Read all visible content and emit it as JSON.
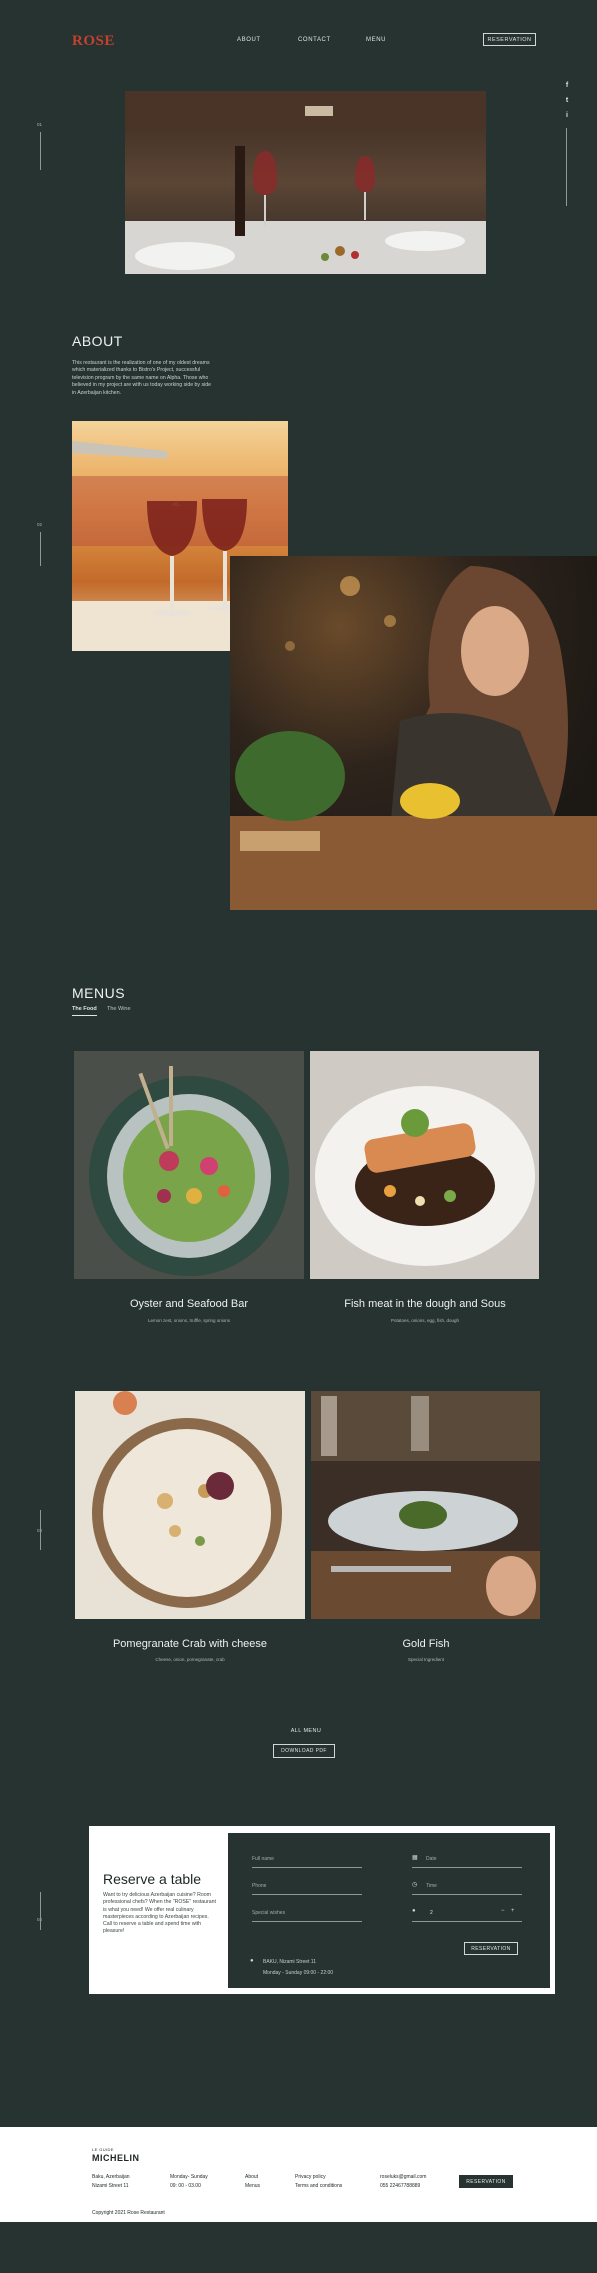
{
  "brand": {
    "name": "ROSE",
    "accent": "#c3412f",
    "background": "#273331"
  },
  "nav": {
    "items": [
      "ABOUT",
      "CONTACT",
      "MENU"
    ],
    "reservation": "RESERVATION"
  },
  "side_markers": [
    "01",
    "02",
    "03",
    "04"
  ],
  "social": {
    "facebook": "f",
    "twitter": "t",
    "instagram": "i"
  },
  "about": {
    "title": "ABOUT",
    "text": "This restaurant is the realization of one of my oldest dreams which materialized thanks to Bistro's Project, successful television program by the same name on Alpha. Those who believed in my project are with us today working side by side in Azerbaijan kitchen."
  },
  "menus": {
    "title": "MENUS",
    "tabs": [
      "The Food",
      "The Wine"
    ],
    "dishes": [
      {
        "name": "Oyster and Seafood Bar",
        "desc": "Lemon zest, onions, truffle, spring onions"
      },
      {
        "name": "Fish meat in the dough and Sous",
        "desc": "Potatoes, onions, egg, fish, dough"
      },
      {
        "name": "Pomegranate Crab with cheese",
        "desc": "Cheese, onion, pomegranate, crab"
      },
      {
        "name": "Gold Fish",
        "desc": "Special Ingredient"
      }
    ],
    "all_menu": "ALL MENU",
    "download": "DOWNLOAD PDF"
  },
  "reservation": {
    "title": "Reserve a table",
    "text": "Want to try delicious Azerbaijan cuisine? Room professional chefs? When the \"ROSE\" restaurant is what you need! We offer real culinary masterpieces according to Azerbaijan recipes. Call to reserve a table and spend time with pleasure!",
    "fields": {
      "full_name": "Full name",
      "phone": "Phone",
      "special": "Special wishes",
      "date": "Date",
      "time": "Time",
      "guests": "2"
    },
    "button": "RESERVATION",
    "address": "BAKU, Nizami Street 11",
    "hours": "Monday - Sunday  09:00 - 22:00"
  },
  "footer": {
    "guide": "LE GUIDE",
    "michelin": "MICHELIN",
    "city": "Baku, Azerbaijan",
    "street": "Nizami Street 11",
    "days": "Monday- Sunday",
    "hours": "09: 00 - 03.00",
    "about": "About",
    "menu": "Menus",
    "privacy": "Privacy policy",
    "terms": "Terms and conditions",
    "email": "roseluks@gmail.com",
    "phone": "055 22467788889",
    "button": "RESERVATION",
    "copyright": "Copyright 2021 Rose Restaurant"
  }
}
